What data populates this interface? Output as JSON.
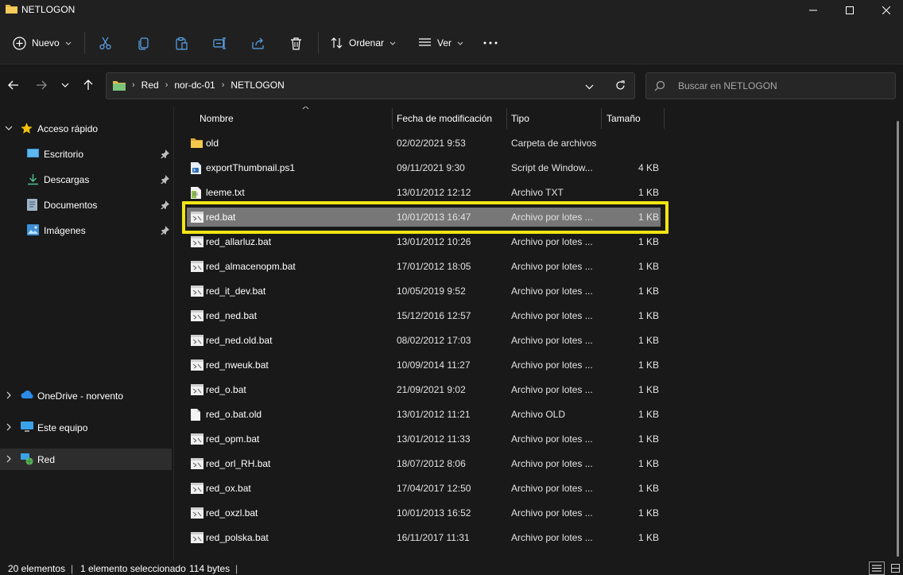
{
  "window": {
    "title": "NETLOGON"
  },
  "commands": {
    "new_label": "Nuevo",
    "sort_label": "Ordenar",
    "view_label": "Ver"
  },
  "address": {
    "crumbs": [
      "Red",
      "nor-dc-01",
      "NETLOGON"
    ]
  },
  "search": {
    "placeholder": "Buscar en NETLOGON"
  },
  "nav": {
    "quick_access": "Acceso rápido",
    "items": [
      {
        "label": "Escritorio",
        "icon": "desktop-icon"
      },
      {
        "label": "Descargas",
        "icon": "downloads-icon"
      },
      {
        "label": "Documentos",
        "icon": "documents-icon"
      },
      {
        "label": "Imágenes",
        "icon": "pictures-icon"
      }
    ],
    "onedrive": "OneDrive - norvento",
    "this_pc": "Este equipo",
    "network": "Red"
  },
  "columns": {
    "name": "Nombre",
    "date": "Fecha de modificación",
    "type": "Tipo",
    "size": "Tamaño"
  },
  "files": [
    {
      "name": "old",
      "date": "02/02/2021 9:53",
      "type": "Carpeta de archivos",
      "size": "",
      "icon": "folder-icon"
    },
    {
      "name": "exportThumbnail.ps1",
      "date": "09/11/2021 9:30",
      "type": "Script de Window...",
      "size": "4 KB",
      "icon": "powershell-script-icon"
    },
    {
      "name": "leeme.txt",
      "date": "13/01/2012 12:12",
      "type": "Archivo TXT",
      "size": "1 KB",
      "icon": "text-file-icon"
    },
    {
      "name": "red.bat",
      "date": "10/01/2013 16:47",
      "type": "Archivo por lotes ...",
      "size": "1 KB",
      "icon": "batch-file-icon",
      "selected": true
    },
    {
      "name": "red_allarluz.bat",
      "date": "13/01/2012 10:26",
      "type": "Archivo por lotes ...",
      "size": "1 KB",
      "icon": "batch-file-icon"
    },
    {
      "name": "red_almacenopm.bat",
      "date": "17/01/2012 18:05",
      "type": "Archivo por lotes ...",
      "size": "1 KB",
      "icon": "batch-file-icon"
    },
    {
      "name": "red_it_dev.bat",
      "date": "10/05/2019 9:52",
      "type": "Archivo por lotes ...",
      "size": "1 KB",
      "icon": "batch-file-icon"
    },
    {
      "name": "red_ned.bat",
      "date": "15/12/2016 12:57",
      "type": "Archivo por lotes ...",
      "size": "1 KB",
      "icon": "batch-file-icon"
    },
    {
      "name": "red_ned.old.bat",
      "date": "08/02/2012 17:03",
      "type": "Archivo por lotes ...",
      "size": "1 KB",
      "icon": "batch-file-icon"
    },
    {
      "name": "red_nweuk.bat",
      "date": "10/09/2014 11:27",
      "type": "Archivo por lotes ...",
      "size": "1 KB",
      "icon": "batch-file-icon"
    },
    {
      "name": "red_o.bat",
      "date": "21/09/2021 9:02",
      "type": "Archivo por lotes ...",
      "size": "1 KB",
      "icon": "batch-file-icon"
    },
    {
      "name": "red_o.bat.old",
      "date": "13/01/2012 11:21",
      "type": "Archivo OLD",
      "size": "1 KB",
      "icon": "blank-file-icon"
    },
    {
      "name": "red_opm.bat",
      "date": "13/01/2012 11:33",
      "type": "Archivo por lotes ...",
      "size": "1 KB",
      "icon": "batch-file-icon"
    },
    {
      "name": "red_orl_RH.bat",
      "date": "18/07/2012 8:06",
      "type": "Archivo por lotes ...",
      "size": "1 KB",
      "icon": "batch-file-icon"
    },
    {
      "name": "red_ox.bat",
      "date": "17/04/2017 12:50",
      "type": "Archivo por lotes ...",
      "size": "1 KB",
      "icon": "batch-file-icon"
    },
    {
      "name": "red_oxzl.bat",
      "date": "10/01/2013 16:52",
      "type": "Archivo por lotes ...",
      "size": "1 KB",
      "icon": "batch-file-icon"
    },
    {
      "name": "red_polska.bat",
      "date": "16/11/2017 11:31",
      "type": "Archivo por lotes ...",
      "size": "1 KB",
      "icon": "batch-file-icon"
    }
  ],
  "status": {
    "count": "20 elementos",
    "selection": "1 elemento seleccionado",
    "size": "114 bytes"
  },
  "colors": {
    "highlight": "#f2e512",
    "selected_row": "#777777",
    "background": "#191919"
  }
}
